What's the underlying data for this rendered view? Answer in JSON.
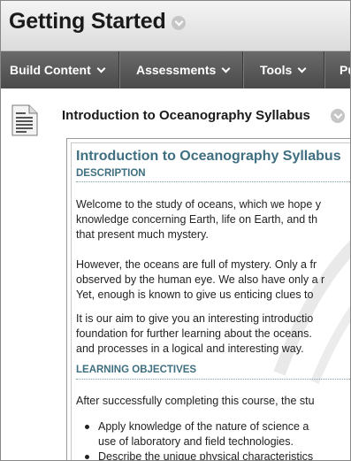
{
  "header": {
    "title": "Getting Started"
  },
  "nav": {
    "items": [
      {
        "label": "Build Content"
      },
      {
        "label": "Assessments"
      },
      {
        "label": "Tools"
      },
      {
        "label": "Pu"
      }
    ]
  },
  "content_item": {
    "title": "Introduction to Oceanography Syllabus",
    "icon": "document-icon"
  },
  "syllabus": {
    "heading": "Introduction to Oceanography Syllabus",
    "description_label": "DESCRIPTION",
    "paragraph1": [
      "Welcome to the study of oceans, which we hope y",
      "knowledge concerning Earth, life on Earth, and th",
      "that present much mystery."
    ],
    "paragraph2": [
      "However, the oceans are full of mystery. Only a fr",
      "observed by the human eye. We also have only a r",
      "Yet, enough is known to give us enticing clues to"
    ],
    "paragraph3": [
      "It is our aim to give you an interesting introductio",
      "foundation for further learning about the oceans.",
      "and processes in a logical and interesting way."
    ],
    "objectives_label": "LEARNING OBJECTIVES",
    "objectives_intro": "After successfully completing this course, the stu",
    "bullets": [
      [
        "Apply knowledge of the nature of science a",
        "use of laboratory and field technologies."
      ],
      [
        "Describe the unique physical characteristics"
      ]
    ]
  },
  "colors": {
    "navbar": "#555555",
    "heading_teal": "#3f6f80"
  }
}
